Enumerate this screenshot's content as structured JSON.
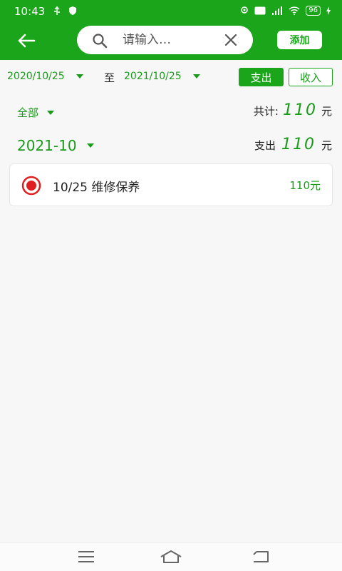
{
  "status_bar": {
    "time": "10:43",
    "battery": "96"
  },
  "header": {
    "search_placeholder": "请输入…",
    "add_label": "添加"
  },
  "date_filter": {
    "start_date": "2020/10/25",
    "to_label": "至",
    "end_date": "2021/10/25",
    "tabs": [
      {
        "label": "支出",
        "active": true
      },
      {
        "label": "收入",
        "active": false
      }
    ]
  },
  "summary": {
    "category": "全部",
    "total_label": "共计:",
    "total_value": "110",
    "unit": "元"
  },
  "month_group": {
    "month": "2021-10",
    "expense_label": "支出",
    "expense_value": "110",
    "unit": "元"
  },
  "records": [
    {
      "date": "10/25",
      "title": "维修保养",
      "amount": "110元"
    }
  ],
  "colors": {
    "accent": "#1aa51a",
    "record_icon": "#e02020"
  }
}
